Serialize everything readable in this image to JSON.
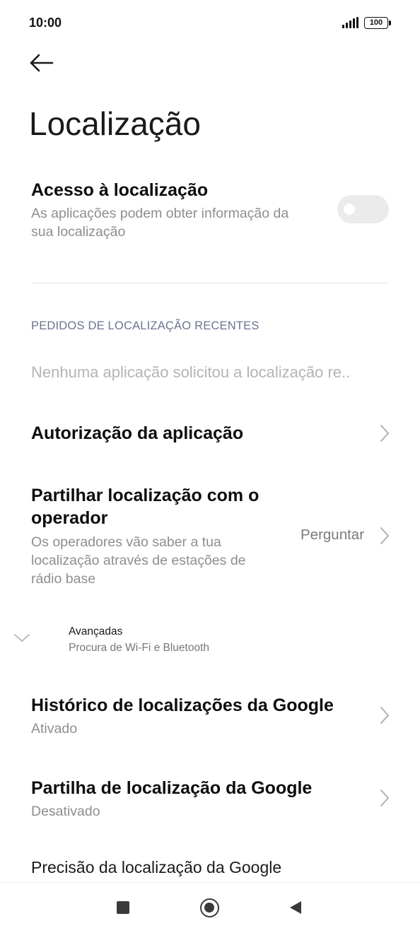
{
  "status_bar": {
    "time": "10:00",
    "battery": "100",
    "signal_icon": "signal-bars-icon",
    "battery_icon": "battery-icon"
  },
  "header": {
    "back_icon": "arrow-left-icon",
    "title": "Localização"
  },
  "location_access": {
    "title": "Acesso à localização",
    "subtitle_line1": "As aplicações podem obter informação da",
    "subtitle_line2": "sua localização",
    "enabled": false
  },
  "recent_requests": {
    "header": "PEDIDOS DE LOCALIZAÇÃO RECENTES",
    "empty_text": "Nenhuma aplicação solicitou a localização re.."
  },
  "app_authorization": {
    "title": "Autorização da aplicação"
  },
  "share_with_operator": {
    "title_line1": "Partilhar localização com o",
    "title_line2": "operador",
    "subtitle_line1": "Os operadores vão saber a tua",
    "subtitle_line2": "localização através de estações de",
    "subtitle_line3": "rádio base",
    "value": "Perguntar"
  },
  "advanced": {
    "title": "Avançadas",
    "subtitle": "Procura de Wi-Fi e Bluetooth"
  },
  "google_location_history": {
    "title": "Histórico de localizações da Google",
    "status": "Ativado"
  },
  "google_location_sharing": {
    "title": "Partilha de localização da Google",
    "status": "Desativado"
  },
  "google_location_accuracy": {
    "title": "Precisão da localização da Google"
  },
  "colors": {
    "background": "#ffffff",
    "title_text": "#0d0d0d",
    "secondary_text": "#8e8e93",
    "section_header": "#6b7390",
    "toggle_off": "#ebebeb"
  }
}
